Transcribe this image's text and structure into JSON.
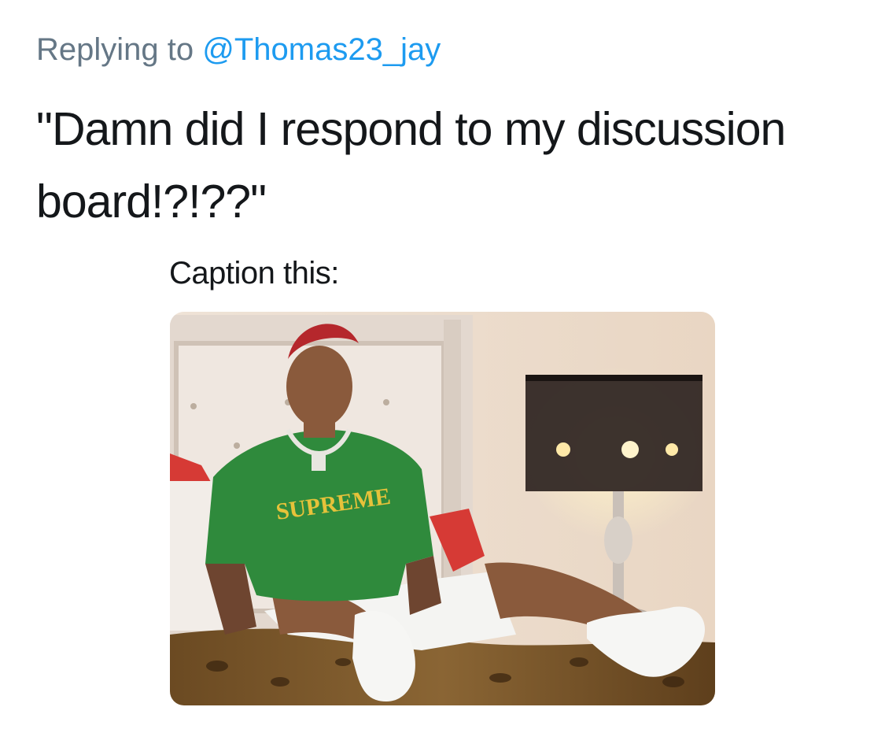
{
  "reply": {
    "prefix": "Replying to",
    "handle": "@Thomas23_jay"
  },
  "tweet": {
    "text": "\"Damn did I respond to my discussion board!?!??\""
  },
  "media": {
    "caption": "Caption this:",
    "shirt_text": "SUPREME"
  },
  "colors": {
    "link": "#1d9bf0",
    "muted": "#657786",
    "text": "#14171a",
    "shirt": "#2f8a3c",
    "shirt_text": "#e6c23a"
  }
}
